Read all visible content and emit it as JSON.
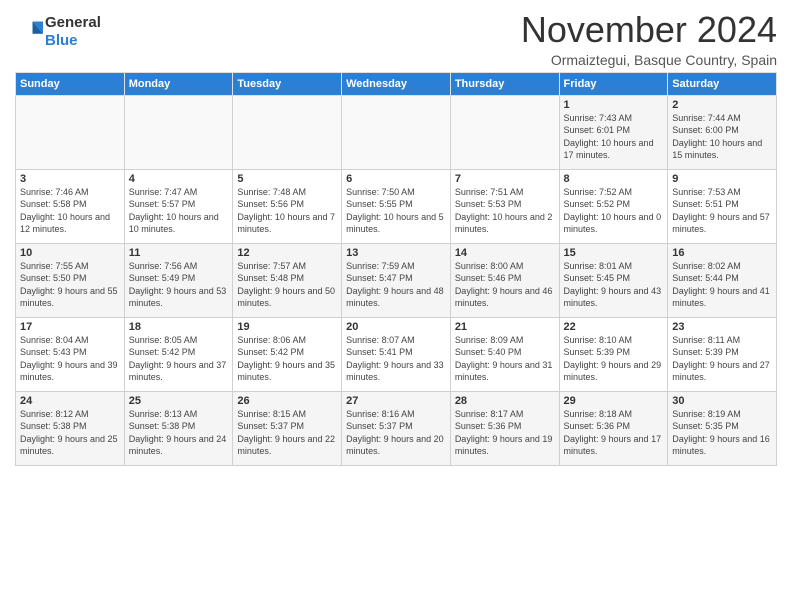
{
  "logo": {
    "line1": "General",
    "line2": "Blue"
  },
  "title": "November 2024",
  "subtitle": "Ormaiztegui, Basque Country, Spain",
  "days_of_week": [
    "Sunday",
    "Monday",
    "Tuesday",
    "Wednesday",
    "Thursday",
    "Friday",
    "Saturday"
  ],
  "weeks": [
    [
      {
        "day": "",
        "info": ""
      },
      {
        "day": "",
        "info": ""
      },
      {
        "day": "",
        "info": ""
      },
      {
        "day": "",
        "info": ""
      },
      {
        "day": "",
        "info": ""
      },
      {
        "day": "1",
        "info": "Sunrise: 7:43 AM\nSunset: 6:01 PM\nDaylight: 10 hours and 17 minutes."
      },
      {
        "day": "2",
        "info": "Sunrise: 7:44 AM\nSunset: 6:00 PM\nDaylight: 10 hours and 15 minutes."
      }
    ],
    [
      {
        "day": "3",
        "info": "Sunrise: 7:46 AM\nSunset: 5:58 PM\nDaylight: 10 hours and 12 minutes."
      },
      {
        "day": "4",
        "info": "Sunrise: 7:47 AM\nSunset: 5:57 PM\nDaylight: 10 hours and 10 minutes."
      },
      {
        "day": "5",
        "info": "Sunrise: 7:48 AM\nSunset: 5:56 PM\nDaylight: 10 hours and 7 minutes."
      },
      {
        "day": "6",
        "info": "Sunrise: 7:50 AM\nSunset: 5:55 PM\nDaylight: 10 hours and 5 minutes."
      },
      {
        "day": "7",
        "info": "Sunrise: 7:51 AM\nSunset: 5:53 PM\nDaylight: 10 hours and 2 minutes."
      },
      {
        "day": "8",
        "info": "Sunrise: 7:52 AM\nSunset: 5:52 PM\nDaylight: 10 hours and 0 minutes."
      },
      {
        "day": "9",
        "info": "Sunrise: 7:53 AM\nSunset: 5:51 PM\nDaylight: 9 hours and 57 minutes."
      }
    ],
    [
      {
        "day": "10",
        "info": "Sunrise: 7:55 AM\nSunset: 5:50 PM\nDaylight: 9 hours and 55 minutes."
      },
      {
        "day": "11",
        "info": "Sunrise: 7:56 AM\nSunset: 5:49 PM\nDaylight: 9 hours and 53 minutes."
      },
      {
        "day": "12",
        "info": "Sunrise: 7:57 AM\nSunset: 5:48 PM\nDaylight: 9 hours and 50 minutes."
      },
      {
        "day": "13",
        "info": "Sunrise: 7:59 AM\nSunset: 5:47 PM\nDaylight: 9 hours and 48 minutes."
      },
      {
        "day": "14",
        "info": "Sunrise: 8:00 AM\nSunset: 5:46 PM\nDaylight: 9 hours and 46 minutes."
      },
      {
        "day": "15",
        "info": "Sunrise: 8:01 AM\nSunset: 5:45 PM\nDaylight: 9 hours and 43 minutes."
      },
      {
        "day": "16",
        "info": "Sunrise: 8:02 AM\nSunset: 5:44 PM\nDaylight: 9 hours and 41 minutes."
      }
    ],
    [
      {
        "day": "17",
        "info": "Sunrise: 8:04 AM\nSunset: 5:43 PM\nDaylight: 9 hours and 39 minutes."
      },
      {
        "day": "18",
        "info": "Sunrise: 8:05 AM\nSunset: 5:42 PM\nDaylight: 9 hours and 37 minutes."
      },
      {
        "day": "19",
        "info": "Sunrise: 8:06 AM\nSunset: 5:42 PM\nDaylight: 9 hours and 35 minutes."
      },
      {
        "day": "20",
        "info": "Sunrise: 8:07 AM\nSunset: 5:41 PM\nDaylight: 9 hours and 33 minutes."
      },
      {
        "day": "21",
        "info": "Sunrise: 8:09 AM\nSunset: 5:40 PM\nDaylight: 9 hours and 31 minutes."
      },
      {
        "day": "22",
        "info": "Sunrise: 8:10 AM\nSunset: 5:39 PM\nDaylight: 9 hours and 29 minutes."
      },
      {
        "day": "23",
        "info": "Sunrise: 8:11 AM\nSunset: 5:39 PM\nDaylight: 9 hours and 27 minutes."
      }
    ],
    [
      {
        "day": "24",
        "info": "Sunrise: 8:12 AM\nSunset: 5:38 PM\nDaylight: 9 hours and 25 minutes."
      },
      {
        "day": "25",
        "info": "Sunrise: 8:13 AM\nSunset: 5:38 PM\nDaylight: 9 hours and 24 minutes."
      },
      {
        "day": "26",
        "info": "Sunrise: 8:15 AM\nSunset: 5:37 PM\nDaylight: 9 hours and 22 minutes."
      },
      {
        "day": "27",
        "info": "Sunrise: 8:16 AM\nSunset: 5:37 PM\nDaylight: 9 hours and 20 minutes."
      },
      {
        "day": "28",
        "info": "Sunrise: 8:17 AM\nSunset: 5:36 PM\nDaylight: 9 hours and 19 minutes."
      },
      {
        "day": "29",
        "info": "Sunrise: 8:18 AM\nSunset: 5:36 PM\nDaylight: 9 hours and 17 minutes."
      },
      {
        "day": "30",
        "info": "Sunrise: 8:19 AM\nSunset: 5:35 PM\nDaylight: 9 hours and 16 minutes."
      }
    ]
  ]
}
